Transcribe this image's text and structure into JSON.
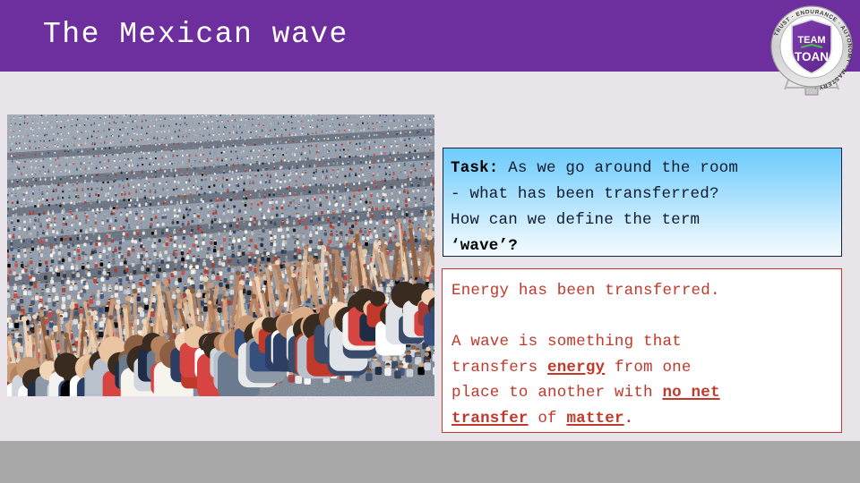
{
  "header": {
    "title": "The Mexican wave",
    "background_color": "#6e2f9e",
    "title_color": "#ffffff"
  },
  "logo": {
    "name": "team-toan-badge",
    "line1": "TEAM",
    "line2": "TOAN",
    "ring_words": [
      "TRUST",
      "ENDURANCE",
      "AUTONOMY",
      "MASTERY"
    ],
    "ring_text": "TRUST · ENDURANCE · AUTONOMY · MASTERY",
    "shield_color": "#6e2f9e",
    "ring_color": "#d4d4d4"
  },
  "photo": {
    "alt": "Stadium crowd doing a Mexican wave",
    "caption": ""
  },
  "task_box": {
    "label": "Task:",
    "body_line1": " As we go around the room",
    "body_line2": "- what has been transferred?",
    "body_line3": "How can we define the term",
    "body_line4": "‘wave’?",
    "border_color": "#17233b",
    "gradient_from": "#6ecbfb",
    "gradient_to": "#f4fbff",
    "text_color": "#101a2e"
  },
  "answer_box": {
    "line1": "Energy has been transferred.",
    "line2": "",
    "line3_a": "A wave is something that",
    "line3_b": "transfers ",
    "emph1": "energy",
    "line3_c": " from one",
    "line4_a": "place to another with ",
    "emph2": "no net",
    "line5_a": "transfer",
    "line5_b": " of ",
    "emph3": "matter",
    "line5_c": ".",
    "border_color": "#c0392b",
    "text_color": "#c0392b",
    "background_color": "#ffffff"
  },
  "footer": {
    "background_color": "#a8a8a8",
    "text": ""
  },
  "page": {
    "background_color": "#e8e4ea"
  }
}
